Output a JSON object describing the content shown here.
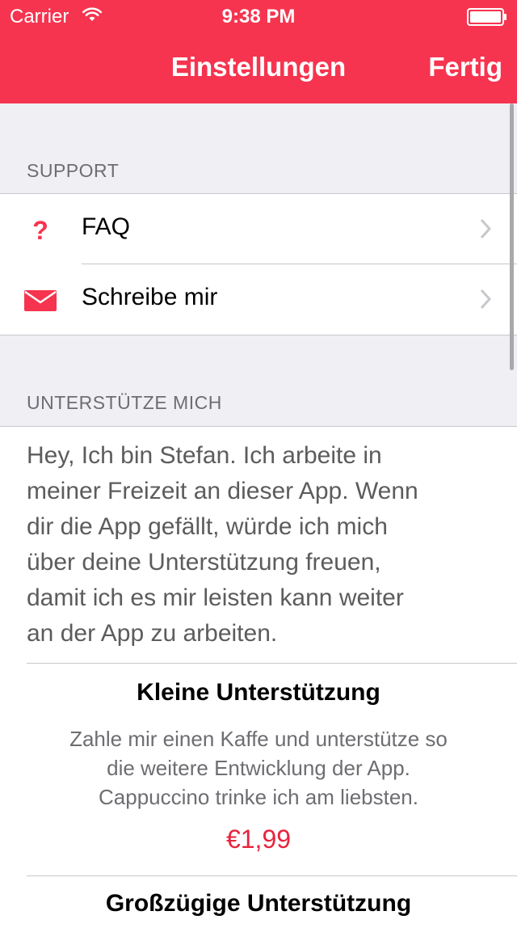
{
  "status_bar": {
    "carrier": "Carrier",
    "time": "9:38 PM"
  },
  "nav": {
    "title": "Einstellungen",
    "done_label": "Fertig"
  },
  "sections": {
    "support": {
      "header": "SUPPORT",
      "items": [
        {
          "label": "FAQ",
          "icon": "question-icon"
        },
        {
          "label": "Schreibe mir",
          "icon": "mail-icon"
        }
      ]
    },
    "donate": {
      "header": "UNTERSTÜTZE MICH",
      "intro_lines": [
        "Hey, Ich bin Stefan. Ich arbeite in",
        "meiner Freizeit an dieser App. Wenn",
        "dir die App gefällt, würde ich mich",
        "über deine Unterstützung freuen,",
        "damit ich es mir leisten kann weiter",
        "an der App zu arbeiten."
      ],
      "tiers": [
        {
          "title": "Kleine Unterstützung",
          "desc_lines": [
            "Zahle mir einen Kaffe und unterstütze so",
            "die weitere Entwicklung der App.",
            "Cappuccino trinke ich am liebsten."
          ],
          "price": "€1,99"
        },
        {
          "title": "Großzügige Unterstützung"
        }
      ]
    }
  },
  "colors": {
    "accent": "#f6344f",
    "price": "#e8243e"
  }
}
